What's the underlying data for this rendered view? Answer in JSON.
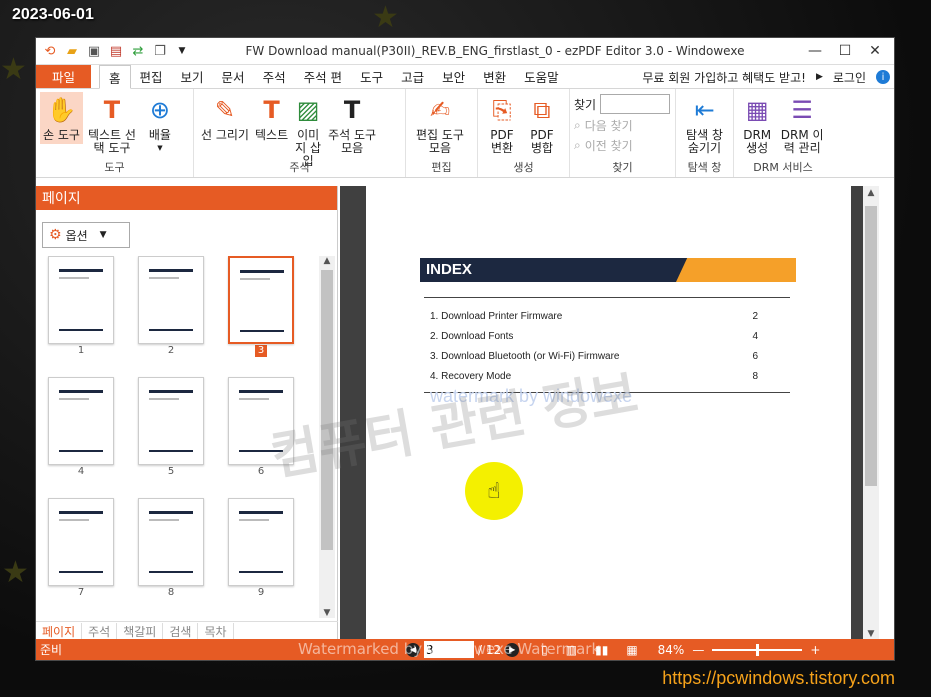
{
  "overlay": {
    "date": "2023-06-01",
    "url": "https://pcwindows.tistory.com",
    "big_watermark": "컴퓨터 관련 정보",
    "status_watermark": "Watermarked by Windowexe Watermark",
    "page_watermark": "watermark by windowexe"
  },
  "titlebar": {
    "title": "FW Download manual(P30II)_REV.B_ENG_firstlast_0 - ezPDF Editor 3.0  - Windowexe",
    "quick_access": [
      "logo-icon",
      "open-folder-icon",
      "save-icon",
      "print-icon",
      "refresh-icon",
      "copy-icon",
      "dropdown-icon"
    ]
  },
  "menu": {
    "file": "파일",
    "tabs": [
      "홈",
      "편집",
      "보기",
      "문서",
      "주석",
      "주석 편",
      "도구",
      "고급",
      "보안",
      "변환",
      "도움말"
    ],
    "promo": "무료 회원 가입하고 혜택도 받고!",
    "login": "로그인"
  },
  "ribbon": {
    "groups": [
      {
        "label": "도구",
        "buttons": [
          {
            "icon": "hand-icon",
            "label": "손 도구",
            "active": true
          },
          {
            "icon": "text-select-icon",
            "label": "텍스트 선택 도구"
          },
          {
            "icon": "zoom-icon",
            "label": "배율"
          }
        ]
      },
      {
        "label": "주석",
        "buttons": [
          {
            "icon": "pen-icon",
            "label": "선 그리기"
          },
          {
            "icon": "text-icon",
            "label": "텍스트"
          },
          {
            "icon": "image-icon",
            "label": "이미지 삽입"
          },
          {
            "icon": "comment-tools-icon",
            "label": "주석 도구 모음"
          }
        ]
      },
      {
        "label": "편집",
        "buttons": [
          {
            "icon": "edit-tools-icon",
            "label": "편집 도구 모음"
          }
        ]
      },
      {
        "label": "생성",
        "buttons": [
          {
            "icon": "pdf-convert-icon",
            "label": "PDF 변환"
          },
          {
            "icon": "pdf-merge-icon",
            "label": "PDF 병합"
          }
        ]
      },
      {
        "label": "찾기",
        "find_label": "찾기",
        "next": "다음 찾기",
        "prev": "이전 찾기"
      },
      {
        "label": "탐색 창",
        "buttons": [
          {
            "icon": "nav-pane-icon",
            "label": "탐색 창 숨기기"
          }
        ]
      },
      {
        "label": "DRM 서비스",
        "buttons": [
          {
            "icon": "drm-create-icon",
            "label": "DRM 생성"
          },
          {
            "icon": "drm-history-icon",
            "label": "DRM 이력 관리"
          }
        ]
      }
    ]
  },
  "pages_panel": {
    "title": "페이지",
    "options": "옵션",
    "thumbnails": [
      "1",
      "2",
      "3",
      "4",
      "5",
      "6",
      "7",
      "8",
      "9",
      "",
      "",
      ""
    ],
    "selected": 3,
    "tabs": [
      "페이지",
      "주석",
      "책갈피",
      "검색",
      "목차"
    ]
  },
  "document": {
    "heading": "INDEX",
    "toc": [
      {
        "title": "1. Download Printer Firmware",
        "page": "2"
      },
      {
        "title": "2. Download Fonts",
        "page": "4"
      },
      {
        "title": "3. Download Bluetooth (or Wi-Fi) Firmware",
        "page": "6"
      },
      {
        "title": "4. Recovery Mode",
        "page": "8"
      }
    ]
  },
  "status": {
    "ready": "준비",
    "current_page": "3",
    "total": "/ 12",
    "zoom": "84%"
  },
  "colors": {
    "accent": "#e65b24",
    "banner_navy": "#1c2840",
    "banner_orange": "#f5a029"
  }
}
